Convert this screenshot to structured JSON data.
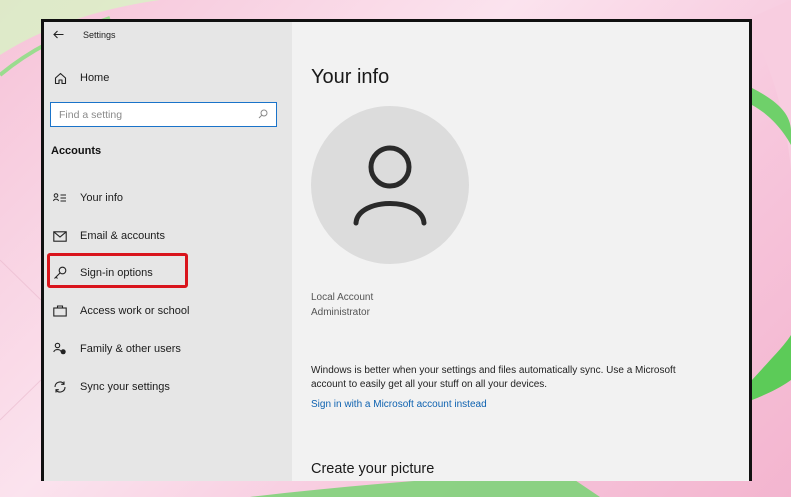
{
  "window": {
    "title": "Settings",
    "back_icon": "arrow-left-icon"
  },
  "sidebar": {
    "home": {
      "label": "Home",
      "icon": "home-icon"
    },
    "search": {
      "placeholder": "Find a setting",
      "value": "",
      "icon": "search-icon"
    },
    "section_heading": "Accounts",
    "items": [
      {
        "label": "Your info",
        "icon": "person-card-icon"
      },
      {
        "label": "Email & accounts",
        "icon": "mail-icon"
      },
      {
        "label": "Sign-in options",
        "icon": "key-icon",
        "highlighted": true
      },
      {
        "label": "Access work or school",
        "icon": "briefcase-icon"
      },
      {
        "label": "Family & other users",
        "icon": "family-icon"
      },
      {
        "label": "Sync your settings",
        "icon": "sync-icon"
      }
    ]
  },
  "main": {
    "title": "Your info",
    "avatar_icon": "user-avatar-icon",
    "account_type": "Local Account",
    "account_role": "Administrator",
    "sync_message": "Windows is better when your settings and files automatically sync. Use a Microsoft account to easily get all your stuff on all your devices.",
    "ms_link": "Sign in with a Microsoft account instead",
    "picture_heading": "Create your picture"
  },
  "colors": {
    "highlight": "#d9141c",
    "link": "#0e62b0",
    "search_border": "#1a73c9",
    "sidebar_bg": "#e6e6e6",
    "main_bg": "#f2f2f2",
    "backdrop_pink": "#f6c3d8",
    "backdrop_green": "#6fd06a"
  }
}
